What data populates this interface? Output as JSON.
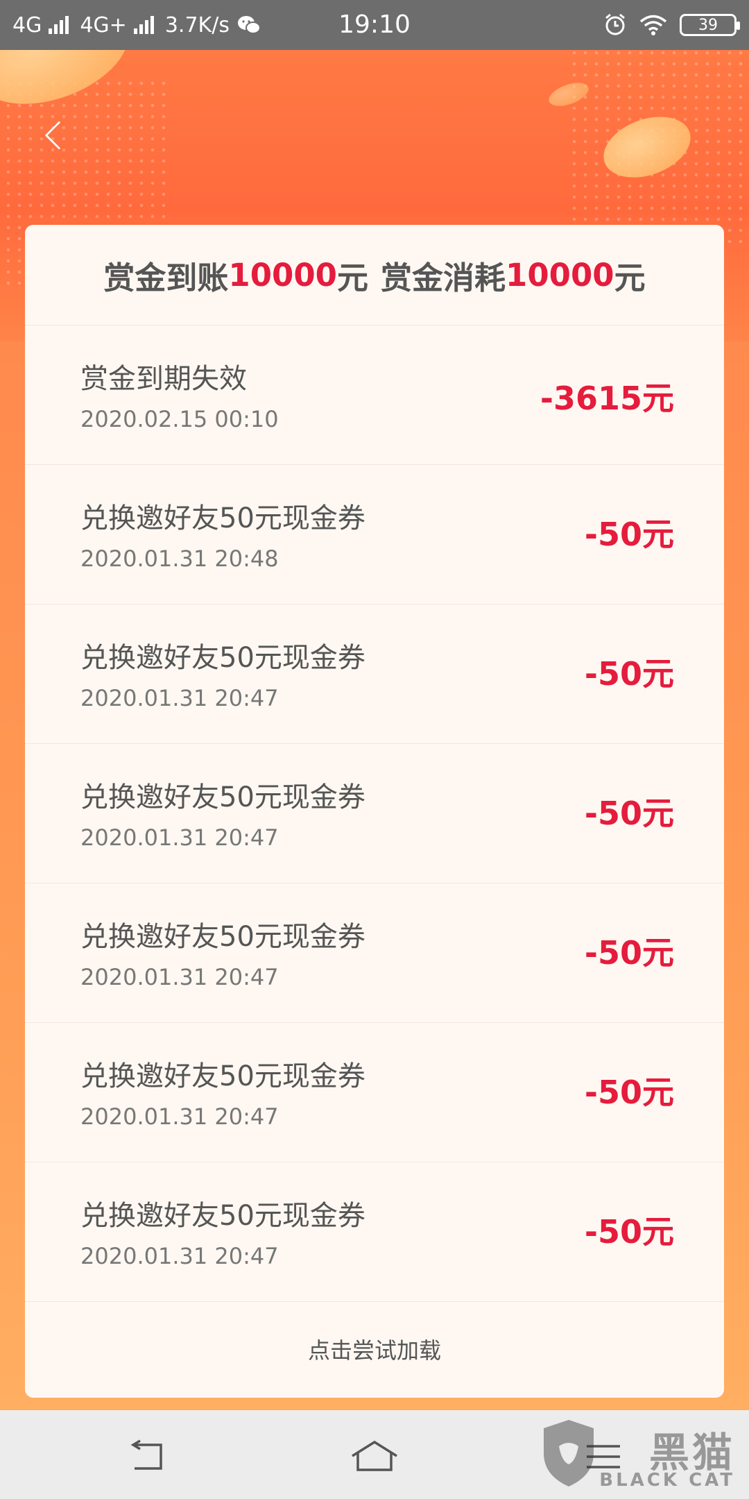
{
  "status_bar": {
    "network1": "4G",
    "network2": "4G+",
    "speed": "3.7K/s",
    "time": "19:10",
    "battery": "39"
  },
  "summary": {
    "label_in": "赏金到账",
    "amount_in": "10000",
    "unit_in": "元",
    "label_out": "赏金消耗",
    "amount_out": "10000",
    "unit_out": "元"
  },
  "records": [
    {
      "title": "赏金到期失效",
      "date": "2020.02.15  00:10",
      "amount": "-3615元"
    },
    {
      "title": "兑换邀好友50元现金券",
      "date": "2020.01.31  20:48",
      "amount": "-50元"
    },
    {
      "title": "兑换邀好友50元现金券",
      "date": "2020.01.31  20:47",
      "amount": "-50元"
    },
    {
      "title": "兑换邀好友50元现金券",
      "date": "2020.01.31  20:47",
      "amount": "-50元"
    },
    {
      "title": "兑换邀好友50元现金券",
      "date": "2020.01.31  20:47",
      "amount": "-50元"
    },
    {
      "title": "兑换邀好友50元现金券",
      "date": "2020.01.31  20:47",
      "amount": "-50元"
    },
    {
      "title": "兑换邀好友50元现金券",
      "date": "2020.01.31  20:47",
      "amount": "-50元"
    }
  ],
  "load_more": "点击尝试加载",
  "watermark": {
    "brand": "黑猫",
    "sub": "BLACK CAT"
  },
  "colors": {
    "accent_red": "#e51c3d",
    "header_orange": "#ff6a3d",
    "card_bg": "#fff8f2"
  }
}
